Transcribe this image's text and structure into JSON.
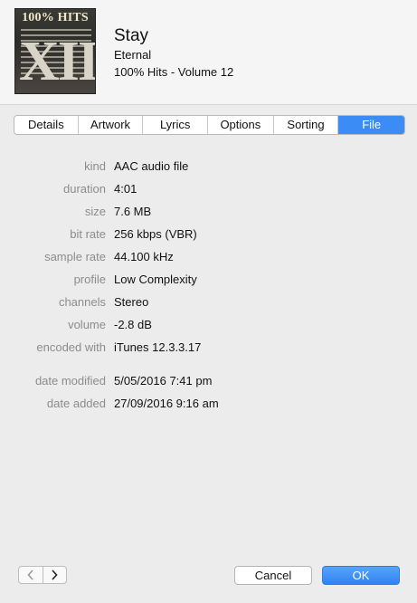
{
  "header": {
    "artwork_icon": "album-artwork",
    "artwork_top_text": "100% HITS",
    "artwork_numeral": "XII",
    "title": "Stay",
    "artist": "Eternal",
    "album": "100% Hits - Volume 12"
  },
  "tabs": [
    {
      "label": "Details",
      "active": false
    },
    {
      "label": "Artwork",
      "active": false
    },
    {
      "label": "Lyrics",
      "active": false
    },
    {
      "label": "Options",
      "active": false
    },
    {
      "label": "Sorting",
      "active": false
    },
    {
      "label": "File",
      "active": true
    }
  ],
  "file_info": {
    "kind": {
      "label": "kind",
      "value": "AAC audio file"
    },
    "duration": {
      "label": "duration",
      "value": "4:01"
    },
    "size": {
      "label": "size",
      "value": "7.6 MB"
    },
    "bit_rate": {
      "label": "bit rate",
      "value": "256 kbps (VBR)"
    },
    "sample_rate": {
      "label": "sample rate",
      "value": "44.100 kHz"
    },
    "profile": {
      "label": "profile",
      "value": "Low Complexity"
    },
    "channels": {
      "label": "channels",
      "value": "Stereo"
    },
    "volume": {
      "label": "volume",
      "value": "-2.8 dB"
    },
    "encoded_with": {
      "label": "encoded with",
      "value": "iTunes 12.3.3.17"
    },
    "date_modified": {
      "label": "date modified",
      "value": "5/05/2016 7:41 pm"
    },
    "date_added": {
      "label": "date added",
      "value": "27/09/2016 9:16 am"
    }
  },
  "footer": {
    "prev_icon": "chevron-left-icon",
    "next_icon": "chevron-right-icon",
    "cancel_label": "Cancel",
    "ok_label": "OK"
  },
  "colors": {
    "accent": "#3b8cf5",
    "label_gray": "#8c8c8c"
  }
}
